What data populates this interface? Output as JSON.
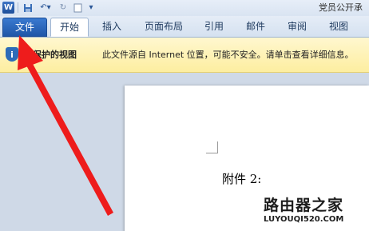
{
  "titlebar": {
    "app_icon": "W",
    "document_title": "党员公开承"
  },
  "ribbon": {
    "tabs": [
      {
        "label": "文件"
      },
      {
        "label": "开始"
      },
      {
        "label": "插入"
      },
      {
        "label": "页面布局"
      },
      {
        "label": "引用"
      },
      {
        "label": "邮件"
      },
      {
        "label": "审阅"
      },
      {
        "label": "视图"
      }
    ]
  },
  "protected_view": {
    "title": "受保护的视图",
    "message": "此文件源自 Internet 位置，可能不安全。请单击查看详细信息。"
  },
  "document": {
    "text": "附件 2:"
  },
  "watermark": {
    "title": "路由器之家",
    "url": "LUYOUQI520.COM"
  },
  "colors": {
    "file_tab": "#2a66bb",
    "message_bar": "#fdf3b8",
    "arrow": "#ee1c1c"
  }
}
